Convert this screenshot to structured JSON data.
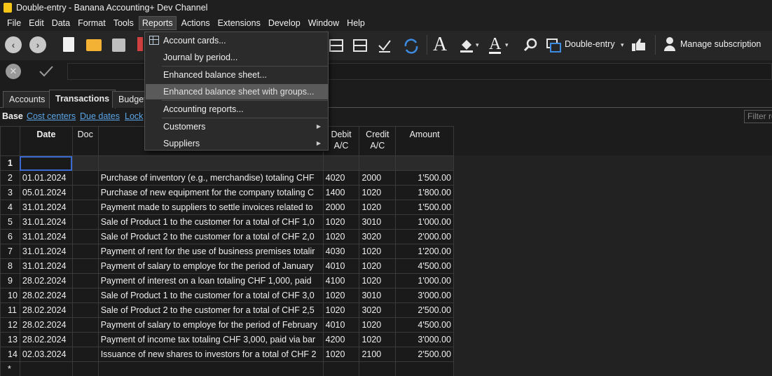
{
  "window": {
    "title": "Double-entry - Banana Accounting+ Dev Channel"
  },
  "menubar": [
    "File",
    "Edit",
    "Data",
    "Format",
    "Tools",
    "Reports",
    "Actions",
    "Extensions",
    "Develop",
    "Window",
    "Help"
  ],
  "toolbar": {
    "file_type": "Double-entry",
    "manage_subscription": "Manage subscription"
  },
  "tabs": [
    "Accounts",
    "Transactions",
    "Budget"
  ],
  "views": [
    "Base",
    "Cost centers",
    "Due dates",
    "Lock"
  ],
  "filter_placeholder": "Filter ro",
  "reports_menu": {
    "items": [
      {
        "label": "Account cards...",
        "icon": "table-icon"
      },
      {
        "label": "Journal by period..."
      },
      {
        "label": "Enhanced balance sheet..."
      },
      {
        "label": "Enhanced balance sheet with groups...",
        "highlighted": true
      },
      {
        "label": "Accounting reports..."
      },
      {
        "label": "Customers",
        "submenu": true
      },
      {
        "label": "Suppliers",
        "submenu": true
      }
    ]
  },
  "table": {
    "columns": [
      "",
      "Date",
      "Doc",
      "",
      "Debit A/C",
      "Credit A/C",
      "Amount"
    ],
    "rows": [
      {
        "n": "1",
        "date": "",
        "doc": "",
        "desc": "",
        "debit": "",
        "credit": "",
        "amount": ""
      },
      {
        "n": "2",
        "date": "01.01.2024",
        "doc": "",
        "desc": "Purchase of inventory (e.g., merchandise) totaling CHF",
        "debit": "4020",
        "credit": "2000",
        "amount": "1'500.00"
      },
      {
        "n": "3",
        "date": "05.01.2024",
        "doc": "",
        "desc": "Purchase of new equipment for the company totaling C",
        "debit": "1400",
        "credit": "1020",
        "amount": "1'800.00"
      },
      {
        "n": "4",
        "date": "31.01.2024",
        "doc": "",
        "desc": "Payment made to suppliers to settle invoices related to",
        "debit": "2000",
        "credit": "1020",
        "amount": "1'500.00"
      },
      {
        "n": "5",
        "date": "31.01.2024",
        "doc": "",
        "desc": "Sale of Product 1 to the customer for a total of CHF 1,0",
        "debit": "1020",
        "credit": "3010",
        "amount": "1'000.00"
      },
      {
        "n": "6",
        "date": "31.01.2024",
        "doc": "",
        "desc": "Sale of Product 2 to the customer for a total of CHF 2,0",
        "debit": "1020",
        "credit": "3020",
        "amount": "2'000.00"
      },
      {
        "n": "7",
        "date": "31.01.2024",
        "doc": "",
        "desc": "Payment of rent for the use of business premises totalir",
        "debit": "4030",
        "credit": "1020",
        "amount": "1'200.00"
      },
      {
        "n": "8",
        "date": "31.01.2024",
        "doc": "",
        "desc": "Payment of salary to employe for the period of January",
        "debit": "4010",
        "credit": "1020",
        "amount": "4'500.00"
      },
      {
        "n": "9",
        "date": "28.02.2024",
        "doc": "",
        "desc": "Payment of interest on a loan totaling CHF 1,000, paid",
        "debit": "4100",
        "credit": "1020",
        "amount": "1'000.00"
      },
      {
        "n": "10",
        "date": "28.02.2024",
        "doc": "",
        "desc": "Sale of Product 1 to the customer for a total of CHF 3,0",
        "debit": "1020",
        "credit": "3010",
        "amount": "3'000.00"
      },
      {
        "n": "11",
        "date": "28.02.2024",
        "doc": "",
        "desc": "Sale of Product 2 to the customer for a total of CHF 2,5",
        "debit": "1020",
        "credit": "3020",
        "amount": "2'500.00"
      },
      {
        "n": "12",
        "date": "28.02.2024",
        "doc": "",
        "desc": "Payment of salary to employe for the period of February",
        "debit": "4010",
        "credit": "1020",
        "amount": "4'500.00"
      },
      {
        "n": "13",
        "date": "28.02.2024",
        "doc": "",
        "desc": "Payment of income tax totaling CHF 3,000, paid via bar",
        "debit": "4200",
        "credit": "1020",
        "amount": "3'000.00"
      },
      {
        "n": "14",
        "date": "02.03.2024",
        "doc": "",
        "desc": "Issuance of new shares to investors for a total of CHF 2",
        "debit": "1020",
        "credit": "2100",
        "amount": "2'500.00"
      },
      {
        "n": "*",
        "date": "",
        "doc": "",
        "desc": "",
        "debit": "",
        "credit": "",
        "amount": ""
      }
    ]
  }
}
